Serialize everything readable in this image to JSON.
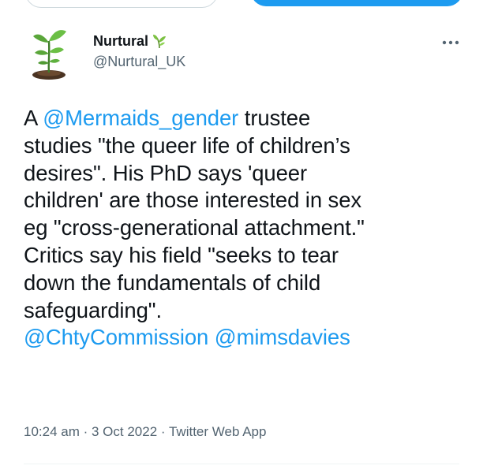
{
  "colors": {
    "text": "#0f1419",
    "secondary": "#536471",
    "link": "#1d9bf0",
    "divider": "#eff3f4"
  },
  "author": {
    "display_name": "Nurtural",
    "name_emoji": "seedling-icon",
    "handle": "@Nurtural_UK",
    "avatar_icon": "sprout-icon"
  },
  "more_icon": "more-dots-icon",
  "tweet": {
    "line1": {
      "prefix": "A ",
      "mention": "@Mermaids_gender",
      "suffix": " trustee"
    },
    "line2": "studies \"the queer life of children’s",
    "line3": "desires\". His PhD says 'queer",
    "line4": "children' are those interested in sex",
    "line5": "eg \"cross-generational attachment.\"",
    "line6": "Critics say his field \"seeks to tear",
    "line7": "down the fundamentals of child",
    "line8": "safeguarding\".",
    "line9": {
      "mention1": "@ChtyCommission",
      "sep": " ",
      "mention2": "@mimsdavies"
    }
  },
  "meta": {
    "time": "10:24 am",
    "sep1": " · ",
    "date": "3 Oct 2022",
    "sep2": " · ",
    "source": "Twitter Web App"
  }
}
